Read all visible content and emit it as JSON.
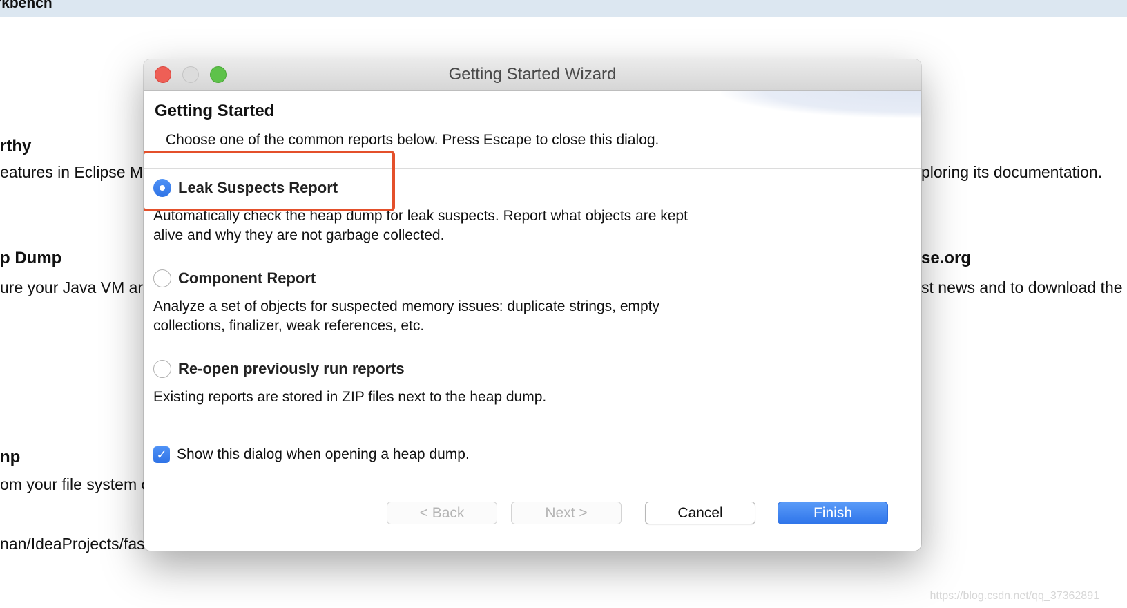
{
  "workbench": {
    "title": "rkbench",
    "fragments": {
      "left_h1": "rthy",
      "left_t1": "eatures in Eclipse M",
      "left_h2": "p Dump",
      "left_t2": "ure your Java VM ar",
      "left_h3": "np",
      "left_t3": "om your file system c",
      "left_t4": "nan/IdeaProjects/fas",
      "right_t1": "ploring its documentation.",
      "right_h2": "se.org",
      "right_t2": "st news and to download the"
    }
  },
  "dialog": {
    "window_title": "Getting Started Wizard",
    "section_title": "Getting Started",
    "section_description": "Choose one of the common reports below. Press Escape to close this dialog.",
    "options": [
      {
        "label": "Leak Suspects Report",
        "selected": true,
        "description_lines": [
          "Automatically check the heap dump for leak suspects. Report what objects are kept",
          "alive and why they are not garbage collected."
        ]
      },
      {
        "label": "Component Report",
        "selected": false,
        "description_lines": [
          "Analyze a set of objects for suspected memory issues: duplicate strings, empty",
          "collections, finalizer, weak references, etc."
        ]
      },
      {
        "label": "Re-open previously run reports",
        "selected": false,
        "description_lines": [
          "Existing reports are stored in ZIP files next to the heap dump."
        ]
      }
    ],
    "show_dialog_checkbox": {
      "label": "Show this dialog when opening a heap dump.",
      "checked": true
    },
    "buttons": {
      "back": "< Back",
      "next": "Next >",
      "cancel": "Cancel",
      "finish": "Finish"
    }
  },
  "watermark": "https://blog.csdn.net/qq_37362891",
  "colors": {
    "accent": "#2f75ea",
    "highlight_box": "#e4502b",
    "close_button": "#ee5f56",
    "maximize_button": "#5ec24a"
  },
  "icons": {
    "close": "close-window-icon",
    "minimize": "minimize-window-icon",
    "maximize": "maximize-window-icon",
    "checkmark": "checkmark-icon"
  }
}
